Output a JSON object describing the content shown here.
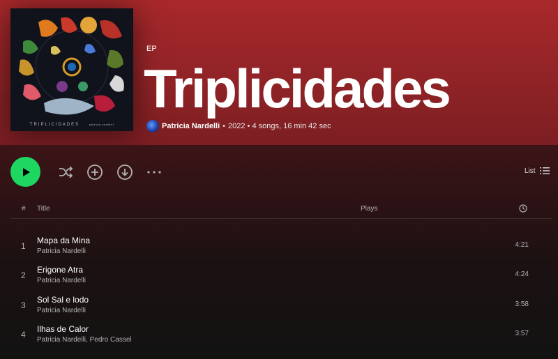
{
  "album": {
    "type": "EP",
    "title": "Triplicidades",
    "artist": "Patricia Nardelli",
    "separator": "•",
    "meta": "2022 • 4 songs, 16 min 42 sec",
    "cover_text": "TRIPLICIDADES",
    "cover_small_text": "patricia nardelli"
  },
  "controls": {
    "icons": [
      "play-icon",
      "shuffle-icon",
      "add-circle-icon",
      "download-icon",
      "more-options-icon",
      "list-view-icon"
    ],
    "view_label": "List"
  },
  "columns": {
    "number": "#",
    "title": "Title",
    "plays": "Plays",
    "duration_icon": "clock-icon"
  },
  "tracks": [
    {
      "number": "1",
      "title": "Mapa da Mina",
      "artist": "Patricia Nardelli",
      "duration": "4:21"
    },
    {
      "number": "2",
      "title": "Erigone Atra",
      "artist": "Patricia Nardelli",
      "duration": "4:24"
    },
    {
      "number": "3",
      "title": "Sol Sal e lodo",
      "artist": "Patricia Nardelli",
      "duration": "3:58"
    },
    {
      "number": "4",
      "title": "Ilhas de Calor",
      "artist": "Patricia Nardelli, Pedro Cassel",
      "duration": "3:57"
    }
  ],
  "colors": {
    "accent_green": "#1ed760",
    "header_red": "#a8282b",
    "background": "#121212"
  }
}
